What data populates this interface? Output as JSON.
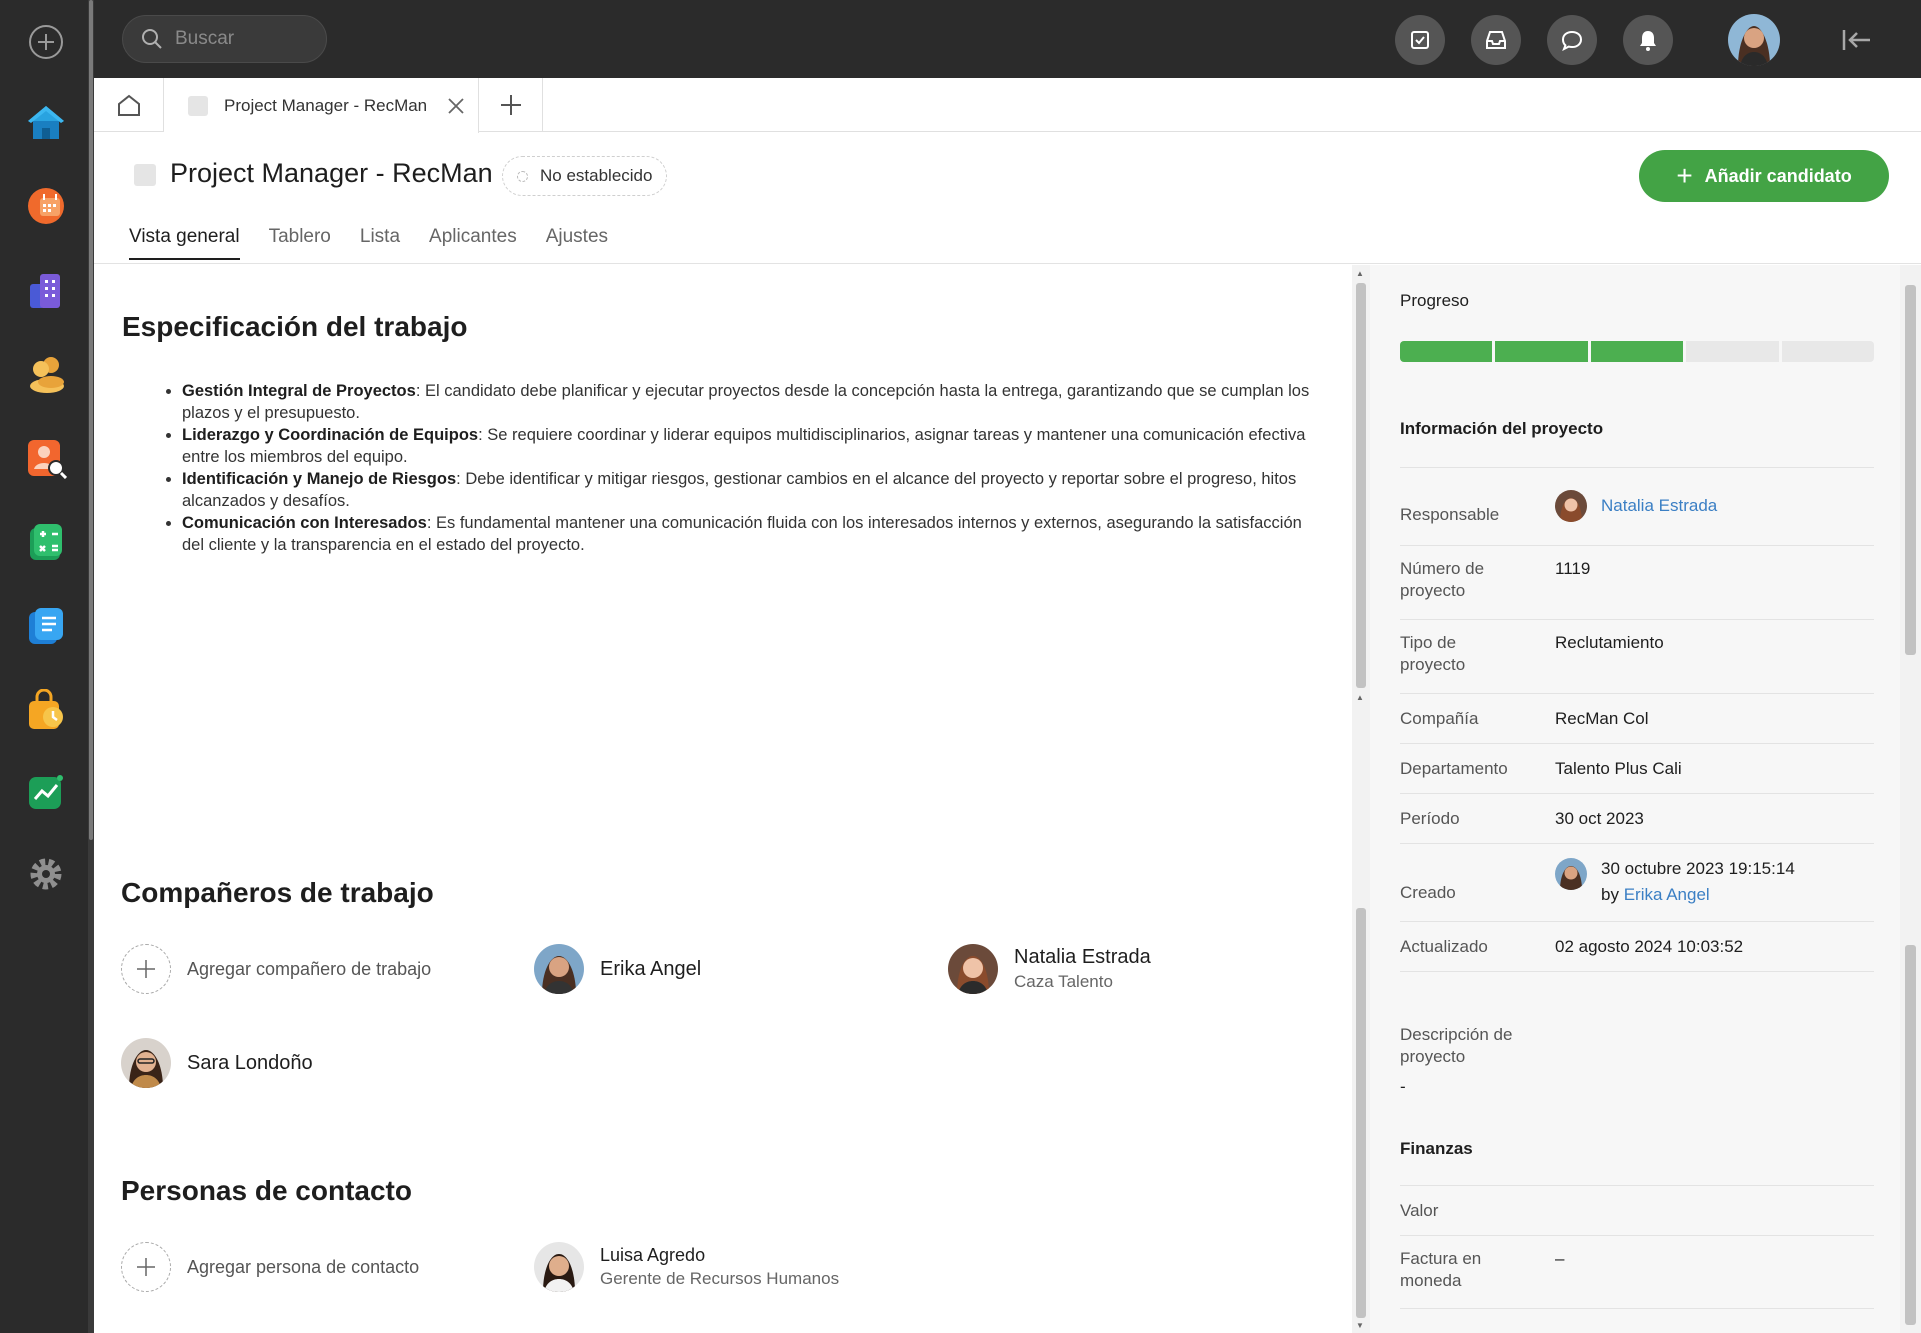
{
  "topbar": {
    "search_placeholder": "Buscar",
    "icons": [
      "tasks-icon",
      "inbox-icon",
      "chat-icon",
      "bell-icon"
    ]
  },
  "tabs": {
    "active_label": "Project Manager - RecMan"
  },
  "header": {
    "title": "Project Manager - RecMan",
    "status": "No establecido",
    "add_candidate": "Añadir candidato",
    "subtabs": [
      "Vista general",
      "Tablero",
      "Lista",
      "Aplicantes",
      "Ajustes"
    ]
  },
  "spec": {
    "heading": "Especificación del trabajo",
    "items": [
      {
        "title": "Gestión Integral de Proyectos",
        "text": ": El candidato debe planificar y ejecutar proyectos desde la concepción hasta la entrega, garantizando que se cumplan los plazos y el presupuesto."
      },
      {
        "title": "Liderazgo y Coordinación de Equipos",
        "text": ": Se requiere coordinar y liderar equipos multidisciplinarios, asignar tareas y mantener una comunicación efectiva entre los miembros del equipo."
      },
      {
        "title": "Identificación y Manejo de Riesgos",
        "text": ": Debe identificar y mitigar riesgos, gestionar cambios en el alcance del proyecto y reportar sobre el progreso, hitos alcanzados y desafíos."
      },
      {
        "title": "Comunicación con Interesados",
        "text": ": Es fundamental mantener una comunicación fluida con los interesados internos y externos, asegurando la satisfacción del cliente y la transparencia en el estado del proyecto."
      }
    ]
  },
  "coworkers": {
    "heading": "Compañeros de trabajo",
    "add_label": "Agregar compañero de trabajo",
    "people": [
      {
        "name": "Erika Angel",
        "role": ""
      },
      {
        "name": "Natalia Estrada",
        "role": "Caza Talento"
      },
      {
        "name": "Sara Londoño",
        "role": ""
      }
    ]
  },
  "contacts": {
    "heading": "Personas de contacto",
    "add_label": "Agregar persona de contacto",
    "people": [
      {
        "name": "Luisa Agredo",
        "role": "Gerente de Recursos Humanos"
      }
    ]
  },
  "sidebar": {
    "progress_title": "Progreso",
    "progress_fraction": 0.6,
    "info_title": "Información del proyecto",
    "rows": {
      "responsable": {
        "k": "Responsable",
        "v": "Natalia Estrada"
      },
      "numero": {
        "k": "Número de proyecto",
        "v": "1119"
      },
      "tipo": {
        "k": "Tipo de proyecto",
        "v": "Reclutamiento"
      },
      "compania": {
        "k": "Compañía",
        "v": "RecMan Col"
      },
      "departamento": {
        "k": "Departamento",
        "v": "Talento Plus Cali"
      },
      "periodo": {
        "k": "Período",
        "v": "30 oct 2023"
      },
      "creado": {
        "k": "Creado",
        "v": "30 octubre 2023 19:15:14",
        "by_prefix": "by",
        "by": "Erika Angel"
      },
      "actualizado": {
        "k": "Actualizado",
        "v": "02 agosto 2024 10:03:52"
      },
      "descripcion": {
        "k": "Descripción de proyecto",
        "v": "-"
      }
    },
    "finance_title": "Finanzas",
    "finance_rows": {
      "valor": {
        "k": "Valor",
        "v": ""
      },
      "factura": {
        "k": "Factura en moneda",
        "v": "–"
      }
    }
  },
  "colors": {
    "accent_green": "#43a345",
    "link_blue": "#3b7fc4",
    "dark_bar": "#2b2b2b"
  }
}
